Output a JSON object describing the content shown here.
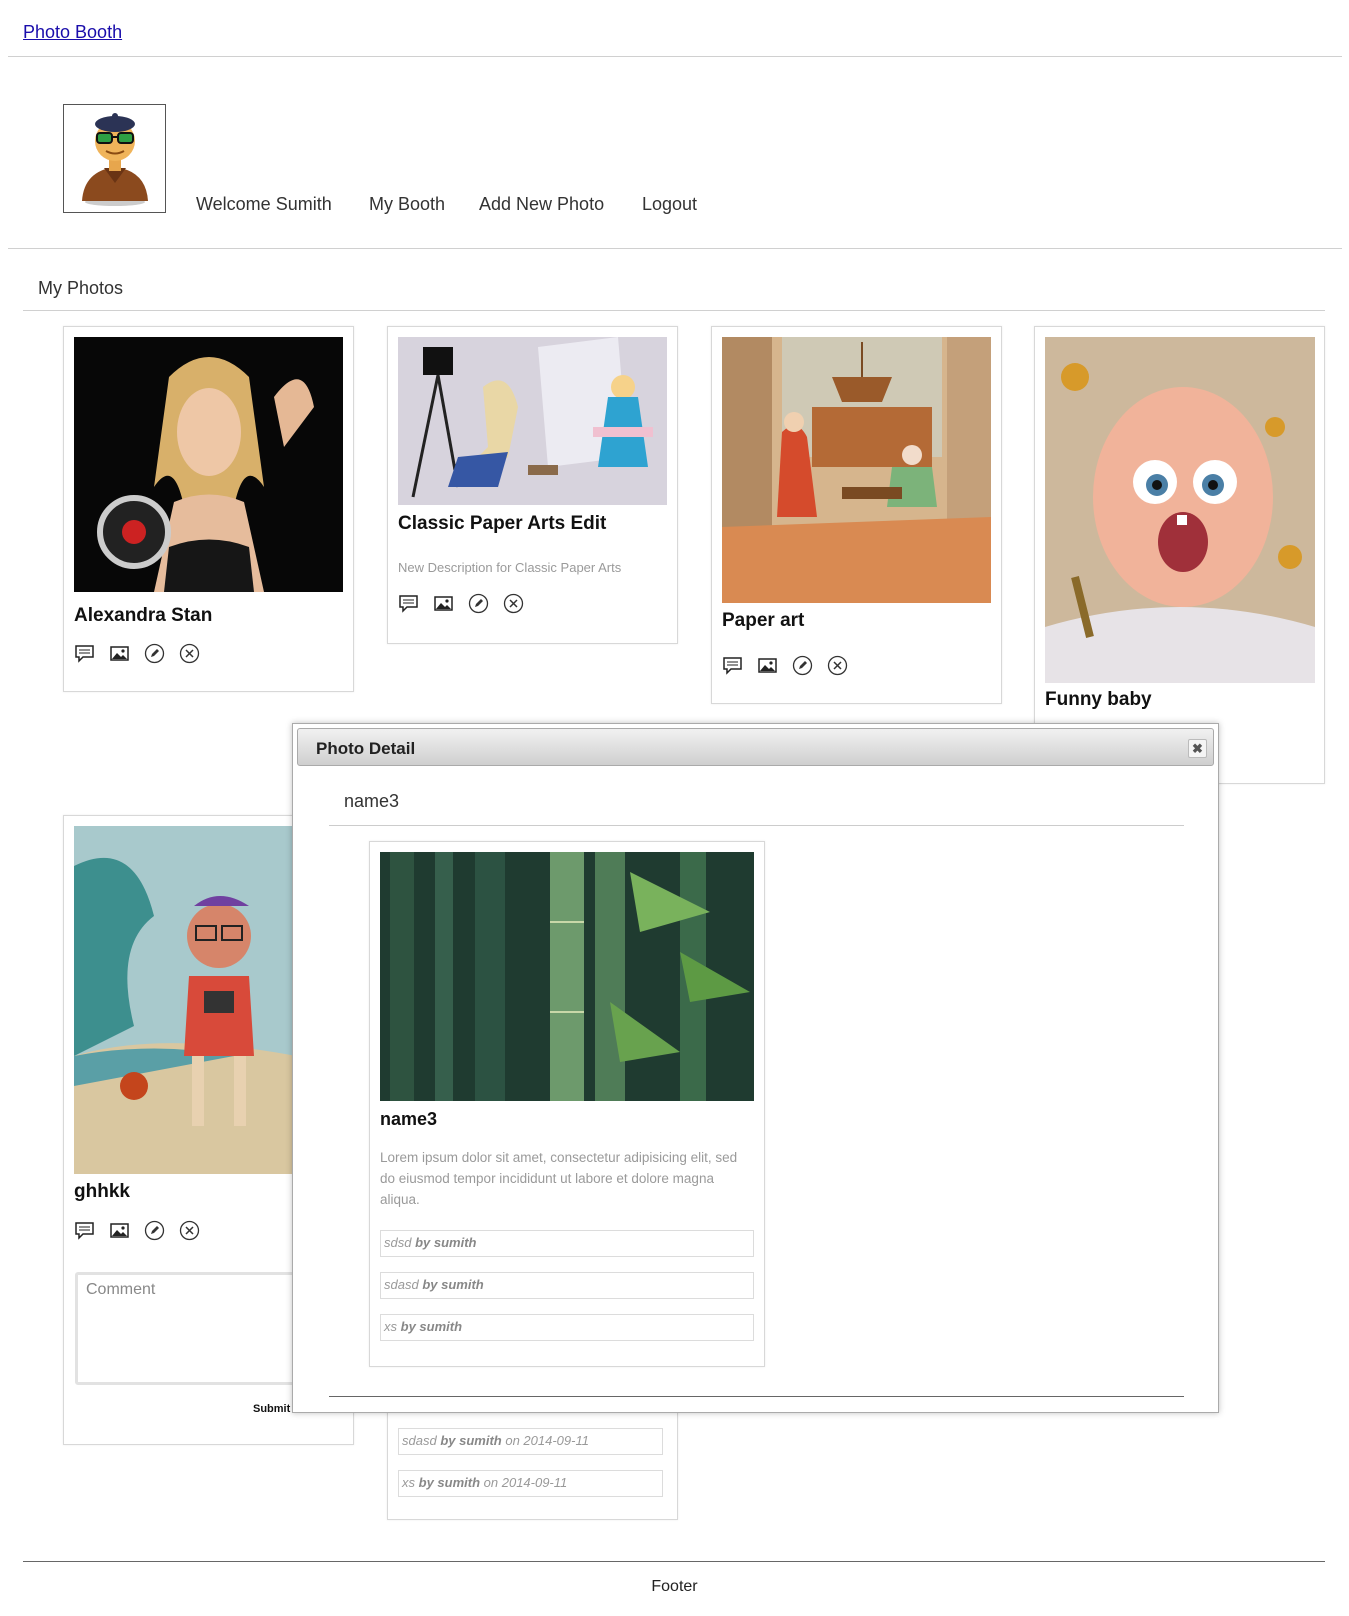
{
  "header": {
    "brand": "Photo Booth"
  },
  "user": {
    "avatar": "user-avatar-icon"
  },
  "nav": {
    "welcome": "Welcome Sumith",
    "my_booth": "My Booth",
    "add_photo": "Add New Photo",
    "logout": "Logout"
  },
  "section": {
    "title": "My Photos"
  },
  "cards": [
    {
      "title": "Alexandra Stan"
    },
    {
      "title": "Classic Paper Arts Edit",
      "description": "New Description for Classic Paper Arts"
    },
    {
      "title": "Paper art"
    },
    {
      "title": "Funny baby"
    },
    {
      "title": "ghhkk",
      "comment_placeholder": "Comment",
      "submit": "Submit"
    }
  ],
  "background_comments": [
    {
      "text": "sdasd",
      "author": "by sumith",
      "date": "on 2014-09-11"
    },
    {
      "text": "xs",
      "author": "by sumith",
      "date": "on 2014-09-11"
    }
  ],
  "icons": [
    "comment-icon",
    "image-icon",
    "edit-icon",
    "delete-icon"
  ],
  "dialog": {
    "title": "Photo Detail",
    "close": "✖",
    "subtitle": "name3",
    "photo_title": "name3",
    "description": "Lorem ipsum dolor sit amet, consectetur adipisicing elit, sed do eiusmod tempor incididunt ut labore et dolore magna aliqua.",
    "comments": [
      {
        "text": "sdsd",
        "author": "by sumith"
      },
      {
        "text": "sdasd",
        "author": "by sumith"
      },
      {
        "text": "xs",
        "author": "by sumith"
      }
    ]
  },
  "footer": {
    "text": "Footer"
  }
}
